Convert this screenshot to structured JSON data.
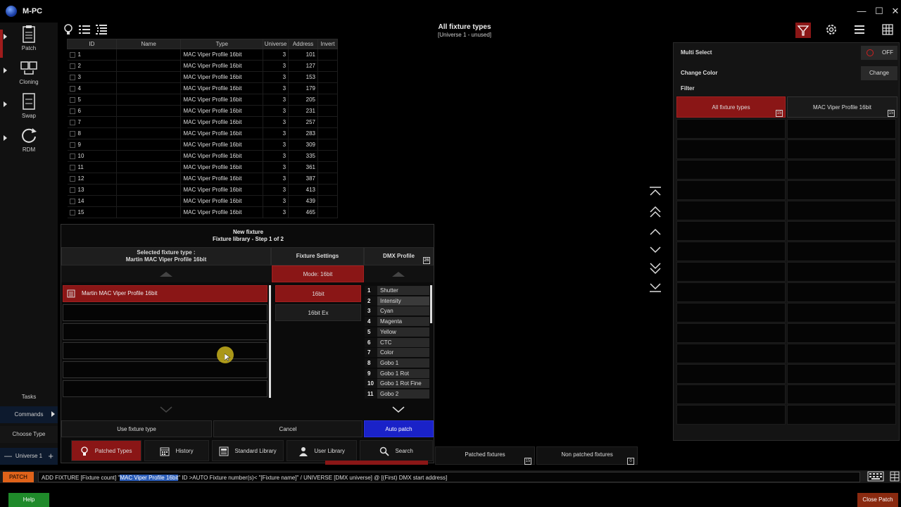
{
  "app": {
    "title": "M-PC"
  },
  "window_controls": {
    "minimize": "—",
    "maximize": "☐",
    "close": "✕"
  },
  "sidebar": {
    "tools": [
      {
        "label": "Patch",
        "icon": "clipboard-icon"
      },
      {
        "label": "Cloning",
        "icon": "cloning-icon"
      },
      {
        "label": "Swap",
        "icon": "swap-icon"
      },
      {
        "label": "RDM",
        "icon": "refresh-icon"
      }
    ],
    "tasks_label": "Tasks",
    "commands_label": "Commands",
    "choose_type_label": "Choose Type",
    "universe_label": "Universe 1",
    "universe_minus": "—",
    "universe_plus": "+"
  },
  "header": {
    "title": "All fixture types",
    "subtitle": "[Universe 1 - unused]"
  },
  "table": {
    "columns": [
      "ID",
      "Name",
      "Type",
      "Universe",
      "Address",
      "Invert"
    ],
    "rows": [
      {
        "id": "1",
        "name": "",
        "type": "MAC Viper Profile 16bit",
        "universe": "3",
        "address": "101"
      },
      {
        "id": "2",
        "name": "",
        "type": "MAC Viper Profile 16bit",
        "universe": "3",
        "address": "127"
      },
      {
        "id": "3",
        "name": "",
        "type": "MAC Viper Profile 16bit",
        "universe": "3",
        "address": "153"
      },
      {
        "id": "4",
        "name": "",
        "type": "MAC Viper Profile 16bit",
        "universe": "3",
        "address": "179"
      },
      {
        "id": "5",
        "name": "",
        "type": "MAC Viper Profile 16bit",
        "universe": "3",
        "address": "205"
      },
      {
        "id": "6",
        "name": "",
        "type": "MAC Viper Profile 16bit",
        "universe": "3",
        "address": "231"
      },
      {
        "id": "7",
        "name": "",
        "type": "MAC Viper Profile 16bit",
        "universe": "3",
        "address": "257"
      },
      {
        "id": "8",
        "name": "",
        "type": "MAC Viper Profile 16bit",
        "universe": "3",
        "address": "283"
      },
      {
        "id": "9",
        "name": "",
        "type": "MAC Viper Profile 16bit",
        "universe": "3",
        "address": "309"
      },
      {
        "id": "10",
        "name": "",
        "type": "MAC Viper Profile 16bit",
        "universe": "3",
        "address": "335"
      },
      {
        "id": "11",
        "name": "",
        "type": "MAC Viper Profile 16bit",
        "universe": "3",
        "address": "361"
      },
      {
        "id": "12",
        "name": "",
        "type": "MAC Viper Profile 16bit",
        "universe": "3",
        "address": "387"
      },
      {
        "id": "13",
        "name": "",
        "type": "MAC Viper Profile 16bit",
        "universe": "3",
        "address": "413"
      },
      {
        "id": "14",
        "name": "",
        "type": "MAC Viper Profile 16bit",
        "universe": "3",
        "address": "439"
      },
      {
        "id": "15",
        "name": "",
        "type": "MAC Viper Profile 16bit",
        "universe": "3",
        "address": "465"
      }
    ]
  },
  "dialog": {
    "title_line1": "New fixture",
    "title_line2": "Fixture library - Step 1 of 2",
    "selected_head_line1": "Selected fixture type :",
    "selected_head_line2": "Martin MAC Viper Profile 16bit",
    "settings_head": "Fixture Settings",
    "dmx_head": "DMX Profile",
    "dmx_badge": "26",
    "mode_label": "Mode: 16bit",
    "fixture_list": [
      "Martin MAC Viper Profile 16bit",
      "",
      "",
      "",
      "",
      ""
    ],
    "modes": [
      "16bit",
      "16bit Ex"
    ],
    "dmx_channels": [
      {
        "n": "1",
        "name": "Shutter"
      },
      {
        "n": "2",
        "name": "Intensity"
      },
      {
        "n": "3",
        "name": "Cyan"
      },
      {
        "n": "4",
        "name": "Magenta"
      },
      {
        "n": "5",
        "name": "Yellow"
      },
      {
        "n": "6",
        "name": "CTC"
      },
      {
        "n": "7",
        "name": "Color"
      },
      {
        "n": "8",
        "name": "Gobo 1"
      },
      {
        "n": "9",
        "name": "Gobo 1 Rot"
      },
      {
        "n": "10",
        "name": "Gobo 1 Rot Fine"
      },
      {
        "n": "11",
        "name": "Gobo 2"
      }
    ],
    "use_fixture_type": "Use fixture type",
    "cancel": "Cancel",
    "auto_patch": "Auto patch",
    "tabs": [
      {
        "label": "Patched Types",
        "icon": "bulb-icon"
      },
      {
        "label": "History",
        "icon": "calendar-icon"
      },
      {
        "label": "Standard Library",
        "icon": "library-icon"
      },
      {
        "label": "User Library",
        "icon": "user-icon"
      },
      {
        "label": "Search",
        "icon": "search-icon"
      }
    ]
  },
  "right_panel": {
    "multi_select_label": "Multi Select",
    "multi_select_state": "OFF",
    "change_color_label": "Change Color",
    "change_button": "Change",
    "filter_label": "Filter",
    "filters": [
      {
        "label": "All fixture types",
        "badge": "15"
      },
      {
        "label": "MAC Viper Profile 16bit",
        "badge": "15"
      }
    ]
  },
  "bottom_tabs": [
    {
      "label": "Patched fixtures",
      "badge": "15"
    },
    {
      "label": "Non patched fixtures",
      "badge": "0"
    }
  ],
  "command": {
    "tag": "PATCH",
    "prefix": "ADD FIXTURE [Fixture count] \"",
    "highlight": "MAC Viper Profile 16bit",
    "suffix": "\" ID >AUTO Fixture number(s)< \"[Fixture name]\" / UNIVERSE [DMX universe] @ [(First) DMX start address]"
  },
  "footer": {
    "help": "Help",
    "close_patch": "Close Patch"
  },
  "colors": {
    "accent_red": "#8a1616",
    "auto_patch_blue": "#1a22c8",
    "patch_tag": "#e0631a",
    "help_green": "#1f8a2a"
  }
}
